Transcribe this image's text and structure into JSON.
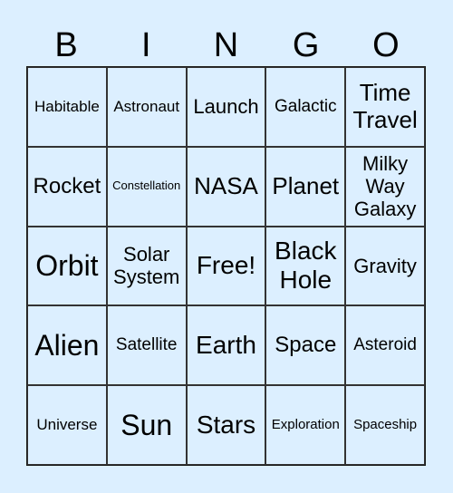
{
  "header": [
    "B",
    "I",
    "N",
    "G",
    "O"
  ],
  "cells": [
    "Habitable",
    "Astronaut",
    "Launch",
    "Galactic",
    "Time Travel",
    "Rocket",
    "Constellation",
    "NASA",
    "Planet",
    "Milky Way Galaxy",
    "Orbit",
    "Solar System",
    "Free!",
    "Black Hole",
    "Gravity",
    "Alien",
    "Satellite",
    "Earth",
    "Space",
    "Asteroid",
    "Universe",
    "Sun",
    "Stars",
    "Exploration",
    "Spaceship"
  ]
}
